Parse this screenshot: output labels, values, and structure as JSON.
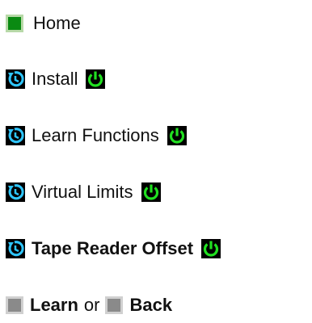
{
  "menu": {
    "home_label": "Home",
    "items": [
      {
        "label": "Install",
        "bold": false
      },
      {
        "label": "Learn Functions",
        "bold": false
      },
      {
        "label": "Virtual Limits",
        "bold": false
      },
      {
        "label": "Tape Reader Offset",
        "bold": true
      }
    ],
    "actions": {
      "learn_label": "Learn",
      "separator_text": "or",
      "back_label": "Back"
    }
  },
  "icons": {
    "home": "green-square-icon",
    "item_leading": "cycle-icon",
    "item_trailing": "power-icon",
    "action": "gray-square-icon"
  },
  "colors": {
    "home_square": "#0a8a12",
    "cycle_bg": "#000000",
    "cycle_fg": "#2ec6ff",
    "power_bg": "#000000",
    "power_fg": "#21e021",
    "action_square": "#8a8a8a"
  }
}
